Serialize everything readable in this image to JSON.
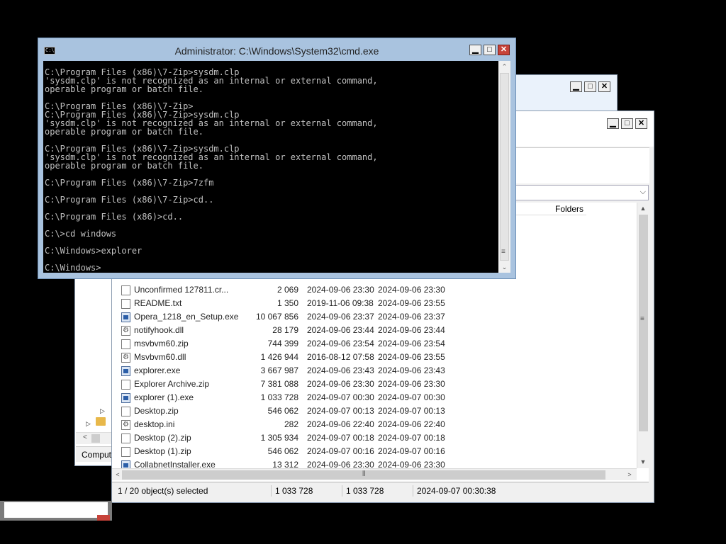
{
  "cmd": {
    "title": "Administrator: C:\\Windows\\System32\\cmd.exe",
    "lines": [
      "C:\\Program Files (x86)\\7-Zip>sysdm.clp",
      "'sysdm.clp' is not recognized as an internal or external command,",
      "operable program or batch file.",
      "",
      "C:\\Program Files (x86)\\7-Zip>",
      "C:\\Program Files (x86)\\7-Zip>sysdm.clp",
      "'sysdm.clp' is not recognized as an internal or external command,",
      "operable program or batch file.",
      "",
      "C:\\Program Files (x86)\\7-Zip>sysdm.clp",
      "'sysdm.clp' is not recognized as an internal or external command,",
      "operable program or batch file.",
      "",
      "C:\\Program Files (x86)\\7-Zip>7zfm",
      "",
      "C:\\Program Files (x86)\\7-Zip>cd..",
      "",
      "C:\\Program Files (x86)>cd..",
      "",
      "C:\\>cd windows",
      "",
      "C:\\Windows>explorer",
      "",
      "C:\\Windows>"
    ]
  },
  "explorer": {
    "column_header": "Folders",
    "files": [
      {
        "name": "Unconfirmed 127811.cr...",
        "size": "2 069",
        "modified": "2024-09-06 23:30",
        "created": "2024-09-06 23:30",
        "icon": "file"
      },
      {
        "name": "README.txt",
        "size": "1 350",
        "modified": "2019-11-06 09:38",
        "created": "2024-09-06 23:55",
        "icon": "file"
      },
      {
        "name": "Opera_1218_en_Setup.exe",
        "size": "10 067 856",
        "modified": "2024-09-06 23:37",
        "created": "2024-09-06 23:37",
        "icon": "exe"
      },
      {
        "name": "notifyhook.dll",
        "size": "28 179",
        "modified": "2024-09-06 23:44",
        "created": "2024-09-06 23:44",
        "icon": "gear"
      },
      {
        "name": "msvbvm60.zip",
        "size": "744 399",
        "modified": "2024-09-06 23:54",
        "created": "2024-09-06 23:54",
        "icon": "file"
      },
      {
        "name": "Msvbvm60.dll",
        "size": "1 426 944",
        "modified": "2016-08-12 07:58",
        "created": "2024-09-06 23:55",
        "icon": "gear"
      },
      {
        "name": "explorer.exe",
        "size": "3 667 987",
        "modified": "2024-09-06 23:43",
        "created": "2024-09-06 23:43",
        "icon": "exe"
      },
      {
        "name": "Explorer Archive.zip",
        "size": "7 381 088",
        "modified": "2024-09-06 23:30",
        "created": "2024-09-06 23:30",
        "icon": "file"
      },
      {
        "name": "explorer (1).exe",
        "size": "1 033 728",
        "modified": "2024-09-07 00:30",
        "created": "2024-09-07 00:30",
        "icon": "exe"
      },
      {
        "name": "Desktop.zip",
        "size": "546 062",
        "modified": "2024-09-07 00:13",
        "created": "2024-09-07 00:13",
        "icon": "file"
      },
      {
        "name": "desktop.ini",
        "size": "282",
        "modified": "2024-09-06 22:40",
        "created": "2024-09-06 22:40",
        "icon": "gear"
      },
      {
        "name": "Desktop (2).zip",
        "size": "1 305 934",
        "modified": "2024-09-07 00:18",
        "created": "2024-09-07 00:18",
        "icon": "file"
      },
      {
        "name": "Desktop (1).zip",
        "size": "546 062",
        "modified": "2024-09-07 00:16",
        "created": "2024-09-07 00:16",
        "icon": "file"
      },
      {
        "name": "CollabnetInstaller.exe",
        "size": "13 312",
        "modified": "2024-09-06 23:30",
        "created": "2024-09-06 23:30",
        "icon": "exe"
      }
    ],
    "status": {
      "selection": "1 / 20 object(s) selected",
      "size": "1 033 728",
      "packed": "1 033 728",
      "modified": "2024-09-07 00:30:38"
    }
  },
  "back_window": {
    "status_text": "Comput"
  }
}
